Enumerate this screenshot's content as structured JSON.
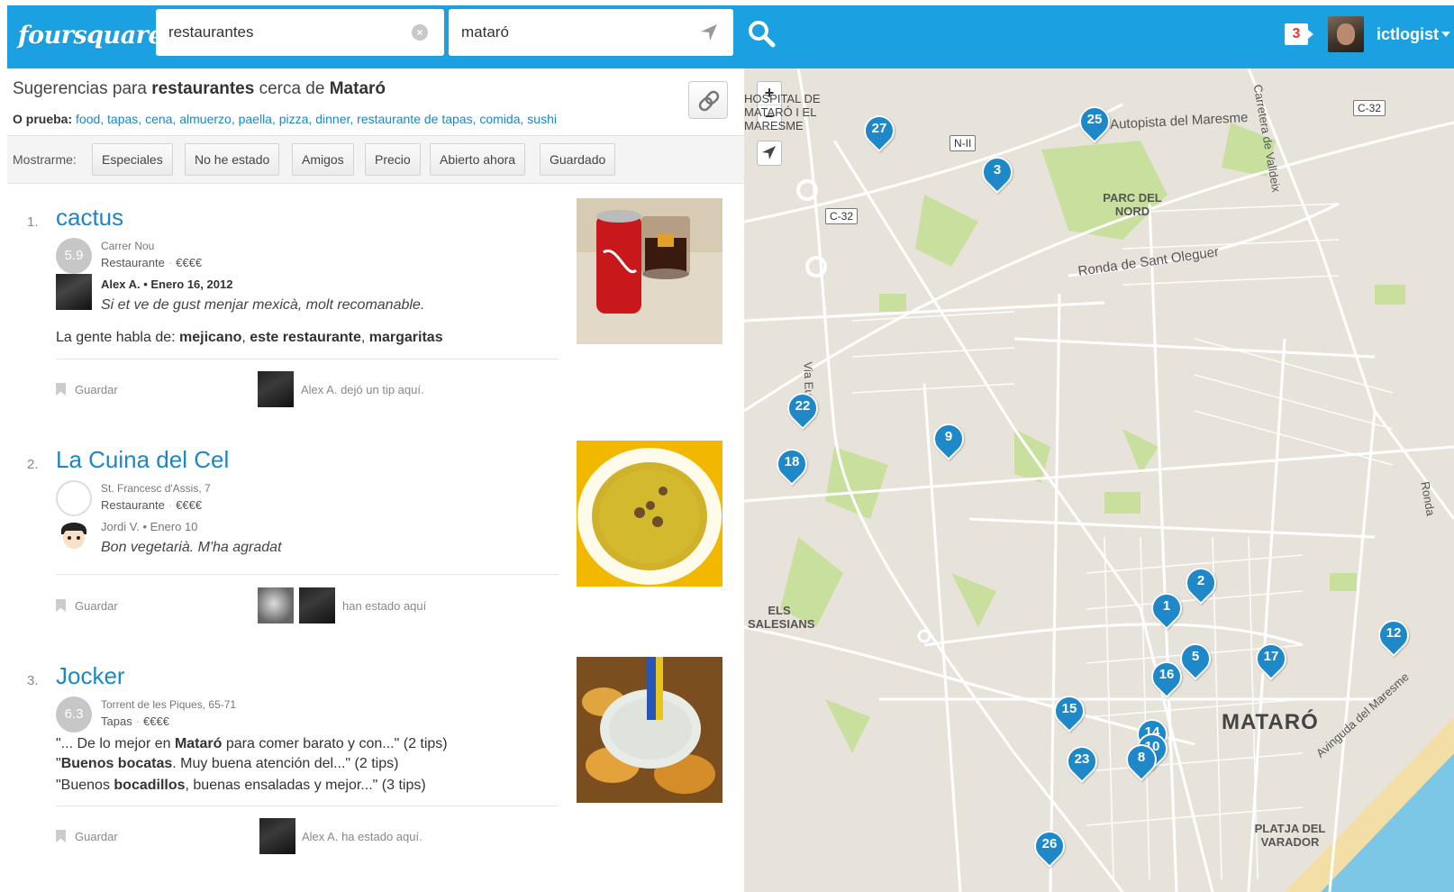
{
  "header": {
    "logo": "foursquare",
    "search_query": "restaurantes",
    "location_query": "mataró",
    "notifications": "3",
    "username": "ictlogist"
  },
  "suggestions": {
    "prefix": "Sugerencias para",
    "query": "restaurantes",
    "middle": "cerca de",
    "place": "Mataró",
    "try_label": "O prueba:",
    "try_links": [
      "food",
      "tapas",
      "cena",
      "almuerzo",
      "paella",
      "pizza",
      "dinner",
      "restaurante de tapas",
      "comida",
      "sushi"
    ]
  },
  "filters": {
    "label": "Mostrarme:",
    "buttons": [
      "Especiales",
      "No he estado",
      "Amigos",
      "Precio",
      "Abierto ahora",
      "Guardado"
    ]
  },
  "venues": [
    {
      "num": "1.",
      "name": "cactus",
      "score": "5.9",
      "address": "Carrer Nou",
      "category": "Restaurante",
      "price": "€€€€",
      "tip_author": "Alex A. • Enero 16, 2012",
      "tip_text": "Si et ve de gust menjar mexicà, molt recomanable.",
      "talk_prefix": "La gente habla de:",
      "talk_terms": [
        "mejicano",
        "este restaurante",
        "margaritas"
      ],
      "save_label": "Guardar",
      "social_text": "Alex A. dejó un tip aquí."
    },
    {
      "num": "2.",
      "name": "La Cuina del Cel",
      "score": "",
      "address": "St. Francesc d'Assis, 7",
      "category": "Restaurante",
      "price": "€€€€",
      "tip_author": "Jordi V. • Enero 10",
      "tip_text": "Bon vegetarià. M'ha agradat",
      "save_label": "Guardar",
      "social_text": "han estado aquí"
    },
    {
      "num": "3.",
      "name": "Jocker",
      "score": "6.3",
      "address": "Torrent de les Piques, 65-71",
      "category": "Tapas",
      "price": "€€€€",
      "quotes": [
        {
          "pre": "\"... De lo mejor en ",
          "bold": "Mataró",
          "post": " para comer barato y con...\" (2 tips)"
        },
        {
          "pre": "\"",
          "bold": "Buenos bocatas",
          "post": ". Muy buena atención del...\" (2 tips)"
        },
        {
          "pre": "\"Buenos ",
          "bold": "bocadillos",
          "post": ", buenas ensaladas y mejor...\" (3 tips)"
        }
      ],
      "save_label": "Guardar",
      "social_text": "Alex A. ha estado aquí."
    }
  ],
  "map": {
    "labels": {
      "hospital": "HOSPITAL DE MATARÓ I EL MARESME",
      "autopista": "Autopista del Maresme",
      "parc": "PARC DEL NORD",
      "ronda": "Ronda de Sant Oleguer",
      "via_europa": "Via Europa",
      "els_salesians": "ELS SALESIANS",
      "mataro": "MATARÓ",
      "platja": "PLATJA DEL VARADOR",
      "avinguda": "Avinguda del Maresme",
      "carretera": "Carretera de Valldeix",
      "ronda_right": "Ronda",
      "road_c32a": "C-32",
      "road_c32b": "C-32",
      "road_n2": "N-II"
    },
    "pins": [
      "27",
      "25",
      "3",
      "22",
      "9",
      "18",
      "2",
      "1",
      "5",
      "16",
      "17",
      "12",
      "15",
      "14",
      "10",
      "23",
      "8",
      "26"
    ]
  }
}
